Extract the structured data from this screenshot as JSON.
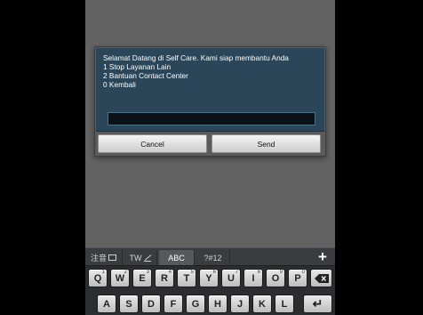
{
  "dialog": {
    "message_lines": [
      "Selamat Datang di Self Care. Kami siap membantu Anda",
      "1 Stop Layanan Lain",
      "2 Bantuan Contact Center",
      "0 Kembali"
    ],
    "input_value": "",
    "cancel_label": "Cancel",
    "send_label": "Send"
  },
  "keyboard": {
    "modes": {
      "zhuyin": "注音",
      "tw": "TW",
      "abc": "ABC",
      "symbols": "?#12"
    },
    "plus_label": "+",
    "row1": [
      {
        "label": "Q",
        "sup": "1"
      },
      {
        "label": "W",
        "sup": "2"
      },
      {
        "label": "E",
        "sup": "3"
      },
      {
        "label": "R",
        "sup": "4"
      },
      {
        "label": "T",
        "sup": "5"
      },
      {
        "label": "Y",
        "sup": "6"
      },
      {
        "label": "U",
        "sup": "7"
      },
      {
        "label": "I",
        "sup": "8"
      },
      {
        "label": "O",
        "sup": "9"
      },
      {
        "label": "P",
        "sup": "0"
      }
    ],
    "row2": [
      "A",
      "S",
      "D",
      "F",
      "G",
      "H",
      "J",
      "K",
      "L"
    ],
    "enter_label": "↵",
    "colors": {
      "dialog_body": "#2b4658",
      "background": "#636363"
    }
  }
}
